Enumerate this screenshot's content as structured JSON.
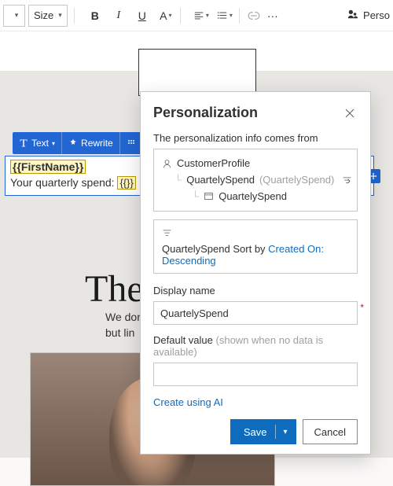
{
  "toolbar": {
    "size_label": "Size",
    "bold": "B",
    "italic": "I",
    "underline": "U",
    "font_style": "A",
    "ellipsis": "···",
    "perso_label": "Perso"
  },
  "sel_toolbar": {
    "text_label": "Text",
    "rewrite_label": "Rewrite"
  },
  "text_block": {
    "token1": "{{FirstName}}",
    "line2_prefix": "Your quarterly spend: ",
    "token2": "{{}}"
  },
  "content": {
    "headline": "The",
    "body_line1": "We don",
    "body_line2": "but lin"
  },
  "panel": {
    "title": "Personalization",
    "source_label": "The personalization info comes from",
    "tree": {
      "root": "CustomerProfile",
      "child": "QuartelySpend",
      "child_type": "(QuartelySpend)",
      "leaf": "QuartelySpend"
    },
    "sort": {
      "field": "QuartelySpend",
      "sort_word": "Sort by",
      "by": "Created On: Descending"
    },
    "display_label": "Display name",
    "display_value": "QuartelySpend",
    "default_label": "Default value",
    "default_hint": "(shown when no data is available)",
    "default_value": "",
    "ai_link": "Create using AI",
    "save_label": "Save",
    "cancel_label": "Cancel"
  }
}
